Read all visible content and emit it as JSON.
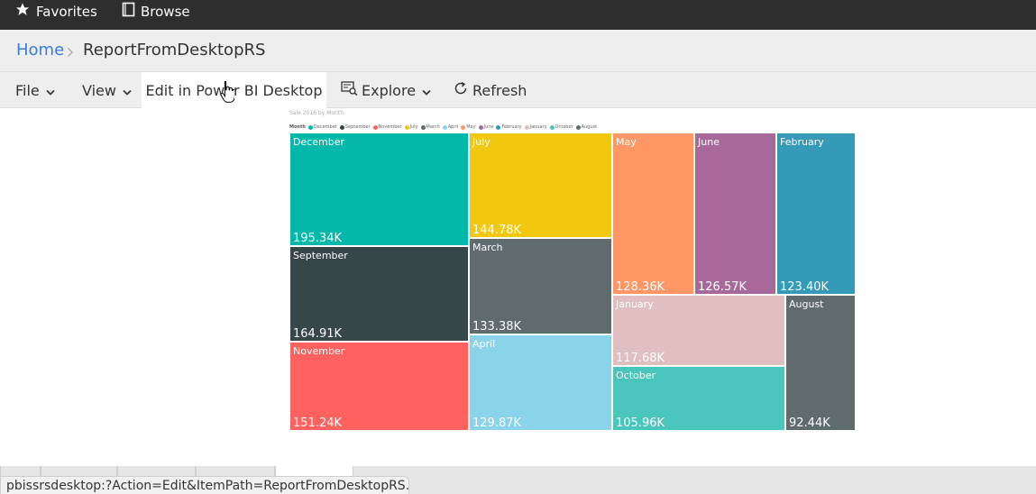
{
  "topbar": {
    "favorites_label": "Favorites",
    "browse_label": "Browse"
  },
  "breadcrumb": {
    "home": "Home",
    "current": "ReportFromDesktopRS"
  },
  "toolbar": {
    "file_label": "File",
    "view_label": "View",
    "edit_label": "Edit in Power BI Desktop",
    "explore_label": "Explore",
    "refresh_label": "Refresh"
  },
  "report": {
    "chart_title": "Sale 2016 by Month",
    "legend_title": "Month"
  },
  "chart_data": {
    "type": "treemap",
    "title": "Sale 2016 by Month",
    "legend_title": "Month",
    "legend_placement": "top-left",
    "legend": [
      "December",
      "September",
      "November",
      "July",
      "March",
      "April",
      "May",
      "June",
      "February",
      "January",
      "October",
      "August"
    ],
    "tiles": [
      {
        "label": "December",
        "value": 195.34,
        "display": "195.34K",
        "color": "#01b8aa"
      },
      {
        "label": "September",
        "value": 164.91,
        "display": "164.91K",
        "color": "#374649"
      },
      {
        "label": "November",
        "value": 151.24,
        "display": "151.24K",
        "color": "#fd625e"
      },
      {
        "label": "July",
        "value": 144.78,
        "display": "144.78K",
        "color": "#f2c80f"
      },
      {
        "label": "March",
        "value": 133.38,
        "display": "133.38K",
        "color": "#5f6b6d"
      },
      {
        "label": "April",
        "value": 129.87,
        "display": "129.87K",
        "color": "#8ad4eb"
      },
      {
        "label": "May",
        "value": 128.36,
        "display": "128.36K",
        "color": "#fe9666"
      },
      {
        "label": "June",
        "value": 126.57,
        "display": "126.57K",
        "color": "#a66999"
      },
      {
        "label": "February",
        "value": 123.4,
        "display": "123.40K",
        "color": "#3599b8"
      },
      {
        "label": "January",
        "value": 117.68,
        "display": "117.68K",
        "color": "#dfbfbf"
      },
      {
        "label": "October",
        "value": 105.96,
        "display": "105.96K",
        "color": "#4ac5bb"
      },
      {
        "label": "August",
        "value": 92.44,
        "display": "92.44K",
        "color": "#5f6b6d"
      }
    ]
  },
  "status": {
    "url_text": "pbissrsdesktop:?Action=Edit&ItemPath=ReportFromDesktopRS..."
  }
}
